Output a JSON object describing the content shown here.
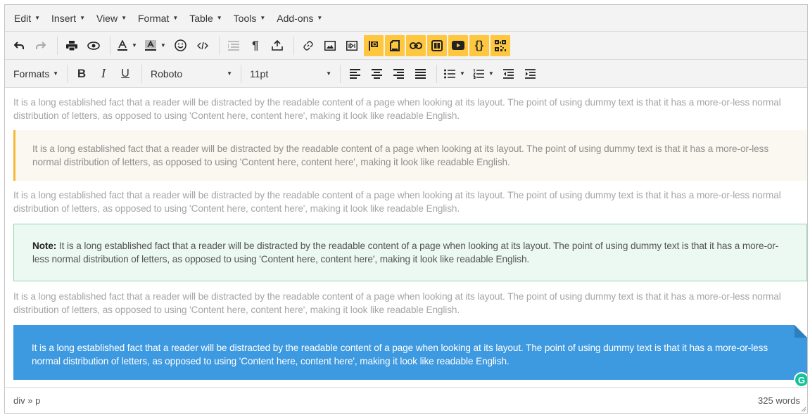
{
  "menubar": {
    "items": [
      {
        "label": "Edit"
      },
      {
        "label": "Insert"
      },
      {
        "label": "View"
      },
      {
        "label": "Format"
      },
      {
        "label": "Table"
      },
      {
        "label": "Tools"
      },
      {
        "label": "Add-ons"
      }
    ]
  },
  "toolbar2": {
    "formats_label": "Formats",
    "bold_glyph": "B",
    "italic_glyph": "I",
    "underline_glyph": "U",
    "font_family": "Roboto",
    "font_size": "11pt"
  },
  "content": {
    "para1": "It is a long established fact that a reader will be distracted by the readable content of a page when looking at its layout. The point of using dummy text is that it has a more-or-less normal distribution of letters, as opposed to using 'Content here, content here', making it look like readable English.",
    "warn_text": "It is a long established fact that a reader will be distracted by the readable content of a page when looking at its layout. The point of using dummy text is that it has a more-or-less normal distribution of letters, as opposed to using 'Content here, content here', making it look like readable English.",
    "para2": "It is a long established fact that a reader will be distracted by the readable content of a page when looking at its layout. The point of using dummy text is that it has a more-or-less normal distribution of letters, as opposed to using 'Content here, content here', making it look like readable English.",
    "note_label": "Note:",
    "note_text": " It is a long established fact that a reader will be distracted by the readable content of a page when looking at its layout. The point of using dummy text is that it has a more-or-less normal distribution of letters, as opposed to using 'Content here, content here', making it look like readable English.",
    "para3": "It is a long established fact that a reader will be distracted by the readable content of a page when looking at its layout. The point of using dummy text is that it has a more-or-less normal distribution of letters, as opposed to using 'Content here, content here', making it look like readable English.",
    "blue_text": "It is a long established fact that a reader will be distracted by the readable content of a page when looking at its layout. The point of using dummy text is that it has a more-or-less normal distribution of letters, as opposed to using 'Content here, content here', making it look like readable English.",
    "badge_glyph": "G"
  },
  "status": {
    "path": "div » p",
    "word_count": "325 words"
  },
  "colors": {
    "highlight": "#ffc73d",
    "warn_border": "#f6b838",
    "note_border": "#93d7b3",
    "blue_box": "#3d99e0",
    "grammarly": "#15c39a"
  }
}
